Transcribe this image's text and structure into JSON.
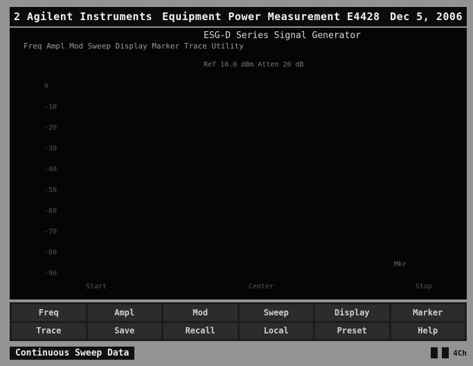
{
  "titlebar": {
    "left": "2 Agilent Instruments",
    "center": "Equipment Power Measurement E4428",
    "right": "Dec 5, 2006"
  },
  "main": {
    "header_line1": "ESG-D Series Signal Generator",
    "header_line2": "Freq   Ampl   Mod   Sweep   Display   Marker   Trace   Utility",
    "header_line3": "Ref  10.0 dBm   Atten 20 dB",
    "row_markers": [
      "0",
      "-10",
      "-20",
      "-30",
      "-40",
      "-50",
      "-60",
      "-70",
      "-80",
      "-90"
    ],
    "col_markers": [
      "Start",
      "",
      "Center",
      "",
      "Stop"
    ],
    "cursor_text": "Mkr"
  },
  "fkeys": [
    "Freq",
    "Ampl",
    "Mod",
    "Sweep",
    "Display",
    "Marker",
    "Trace",
    "Save",
    "Recall",
    "Local",
    "Preset",
    "Help"
  ],
  "statusbar": {
    "text": "Continuous Sweep Data",
    "right_label": "4Ch"
  }
}
